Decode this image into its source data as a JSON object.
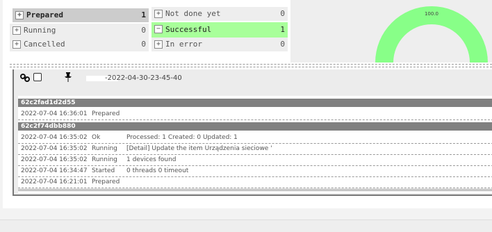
{
  "status_filters": {
    "prepared": {
      "label": "Prepared",
      "count": "1"
    },
    "not_done_yet": {
      "label": "Not done yet",
      "count": "0"
    },
    "running": {
      "label": "Running",
      "count": "0"
    },
    "successful": {
      "label": "Successful",
      "count": "1"
    },
    "cancelled": {
      "label": "Cancelled",
      "count": "0"
    },
    "in_error": {
      "label": "In error",
      "count": "0"
    }
  },
  "gauge": {
    "value_text": "100.0",
    "value": 100,
    "color": "#88ff88"
  },
  "task": {
    "title_suffix": "-2022-04-30-23-45-40",
    "groups": [
      {
        "id": "62c2fad1d2d55",
        "rows": [
          {
            "date": "2022-07-04 16:36:01",
            "state": "Prepared",
            "message": ""
          }
        ]
      },
      {
        "id": "62c2f74dbb880",
        "rows": [
          {
            "date": "2022-07-04 16:35:02",
            "state": "Ok",
            "message": "Processed: 1 Created: 0 Updated: 1"
          },
          {
            "date": "2022-07-04 16:35:02",
            "state": "Running",
            "message": "[Detail] Update the item Urządzenia sieciowe '"
          },
          {
            "date": "2022-07-04 16:35:02",
            "state": "Running",
            "message": "1 devices found"
          },
          {
            "date": "2022-07-04 16:34:47",
            "state": "Started",
            "message": "0 threads 0 timeout"
          },
          {
            "date": "2022-07-04 16:21:01",
            "state": "Prepared",
            "message": ""
          }
        ]
      }
    ]
  },
  "colors": {
    "success": "#a8ff9a",
    "selected": "#cccccc",
    "group_header": "#808080"
  }
}
